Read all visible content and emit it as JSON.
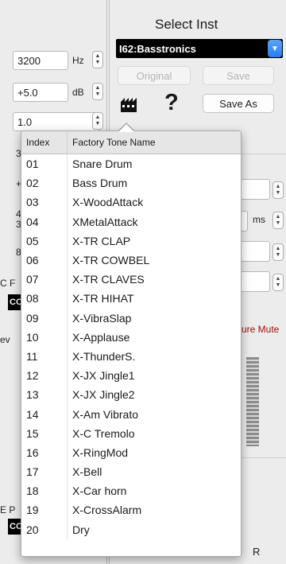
{
  "inst_panel": {
    "title": "Select Inst",
    "selected": "I62:Basstronics",
    "original_label": "Original",
    "save_label": "Save",
    "save_as_label": "Save As",
    "help_glyph": "?"
  },
  "left_params": {
    "freq_value": "3200",
    "freq_unit": "Hz",
    "gain_value": "+5.0",
    "gain_unit": "dB",
    "q_value": "1.0",
    "partial_a": "3",
    "partial_b": "+",
    "partial_c": "4",
    "partial_d": "3",
    "partial_e": "8",
    "partial_f": "C F",
    "partial_g": "CO",
    "partial_h": "ev",
    "partial_i": "E P",
    "partial_j": "CO"
  },
  "right_params": {
    "ms_unit": "ms",
    "mute_label": "ure Mute",
    "r_label": "R"
  },
  "popup": {
    "header_index": "Index",
    "header_name": "Factory Tone Name",
    "rows": [
      {
        "index": "01",
        "name": "Snare Drum"
      },
      {
        "index": "02",
        "name": "Bass Drum"
      },
      {
        "index": "03",
        "name": "X-WoodAttack"
      },
      {
        "index": "04",
        "name": "XMetalAttack"
      },
      {
        "index": "05",
        "name": "X-TR CLAP"
      },
      {
        "index": "06",
        "name": "X-TR COWBEL"
      },
      {
        "index": "07",
        "name": "X-TR CLAVES"
      },
      {
        "index": "08",
        "name": "X-TR HIHAT"
      },
      {
        "index": "09",
        "name": "X-VibraSlap"
      },
      {
        "index": "10",
        "name": "X-Applause"
      },
      {
        "index": "11",
        "name": "X-ThunderS."
      },
      {
        "index": "12",
        "name": "X-JX Jingle1"
      },
      {
        "index": "13",
        "name": "X-JX Jingle2"
      },
      {
        "index": "14",
        "name": "X-Am Vibrato"
      },
      {
        "index": "15",
        "name": "X-C Tremolo"
      },
      {
        "index": "16",
        "name": "X-RingMod"
      },
      {
        "index": "17",
        "name": "X-Bell"
      },
      {
        "index": "18",
        "name": "X-Car horn"
      },
      {
        "index": "19",
        "name": "X-CrossAlarm"
      },
      {
        "index": "20",
        "name": "Dry"
      }
    ]
  },
  "colors": {
    "accent": "#2a7ef0",
    "mute_text": "#a01010"
  }
}
